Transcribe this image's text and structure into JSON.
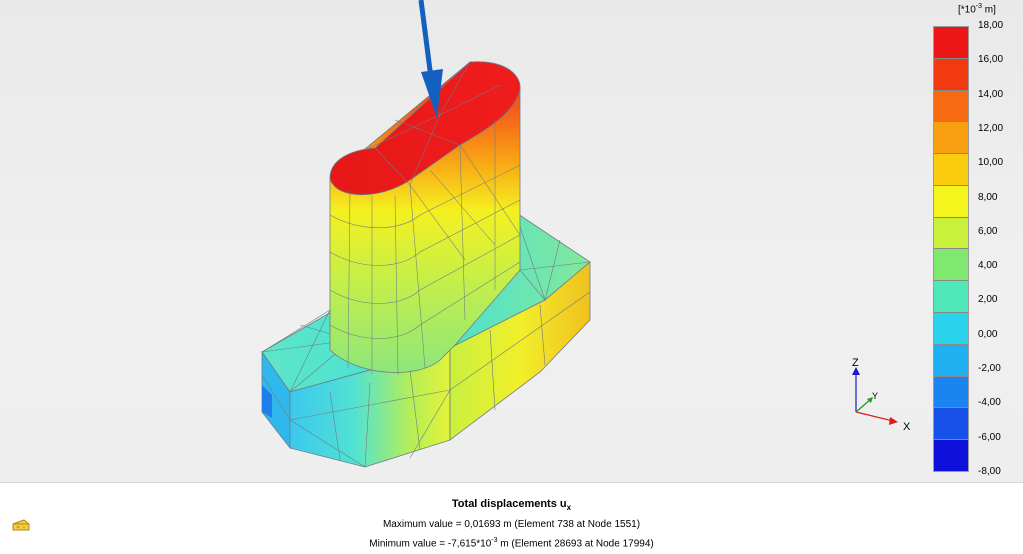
{
  "legend": {
    "unit_prefix": "[*10",
    "unit_exponent": "-3",
    "unit_suffix": " m]",
    "ticks": [
      "18,00",
      "16,00",
      "14,00",
      "12,00",
      "10,00",
      "8,00",
      "6,00",
      "4,00",
      "2,00",
      "0,00",
      "-2,00",
      "-4,00",
      "-6,00",
      "-8,00"
    ],
    "colors": [
      "#ec1616",
      "#f23a10",
      "#f66a12",
      "#f9a012",
      "#fbcd0e",
      "#f4f51c",
      "#c9f03a",
      "#7ee86f",
      "#4ee8b8",
      "#2ad3ec",
      "#20b0f2",
      "#1c84f0",
      "#1550e8",
      "#1010dc"
    ]
  },
  "axes": {
    "z_label": "Z",
    "y_label": "Y",
    "x_label": "X"
  },
  "results": {
    "title_main": "Total displacements u",
    "title_sub": "x",
    "max_text": "Maximum value = 0,01693 m (Element 738 at Node 1551)",
    "min_prefix": "Minimum value = -7,615*10",
    "min_exponent": "-3",
    "min_suffix": " m (Element 28693 at Node 17994)"
  },
  "icons": {
    "cheese": "cheese-icon"
  }
}
